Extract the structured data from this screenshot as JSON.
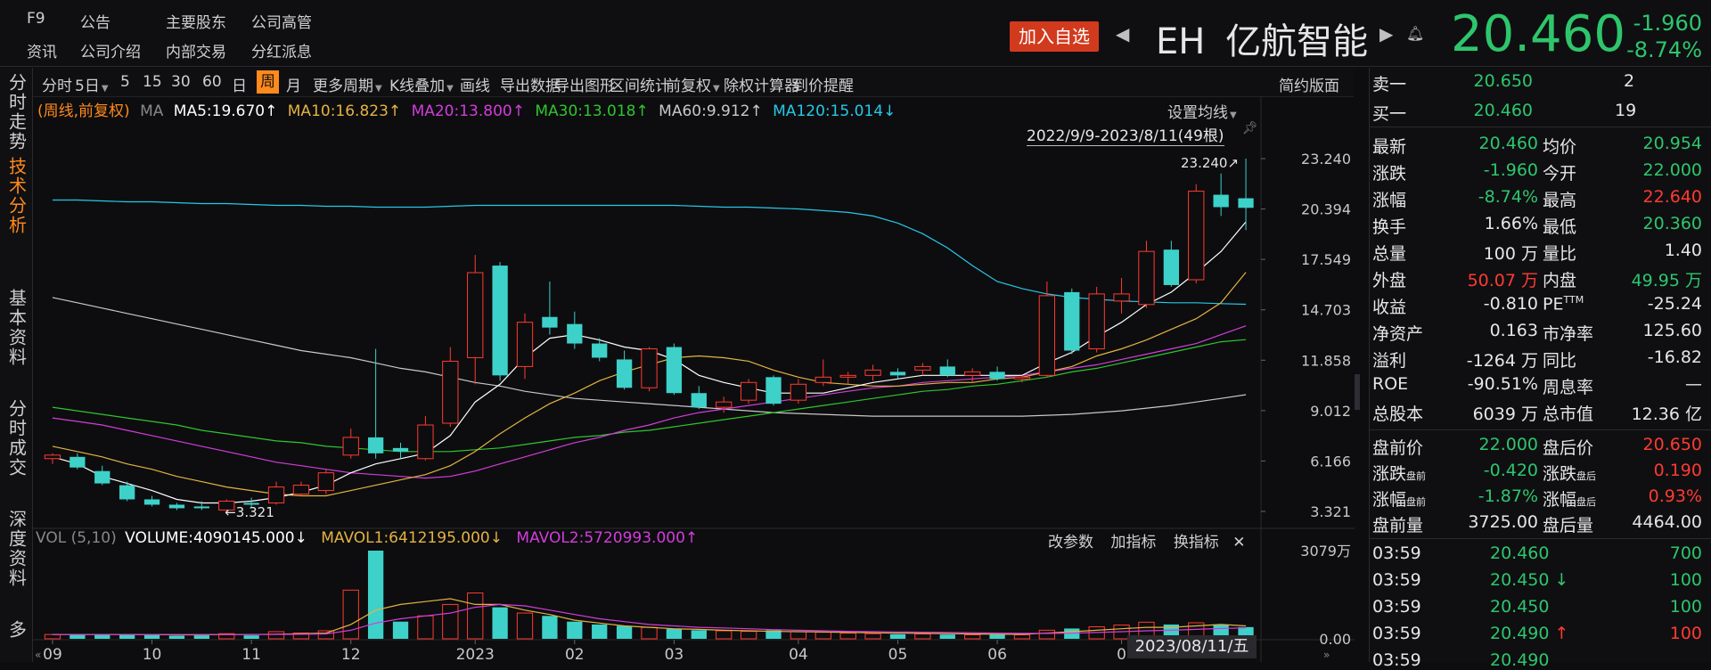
{
  "top_nav": {
    "row1": [
      "F9",
      "公告",
      "主要股东",
      "公司高管"
    ],
    "row2": [
      "资讯",
      "公司介绍",
      "内部交易",
      "分红派息"
    ]
  },
  "header": {
    "add_watch": "加入自选",
    "symbol": "EH",
    "name": "亿航智能",
    "price": "20.460",
    "change": "-1.960",
    "change_pct": "-8.74%"
  },
  "sidebar": [
    "分时走势",
    "技术分析",
    "基本资料",
    "分时成交",
    "深度资料",
    "多"
  ],
  "sidebar_active_index": 1,
  "toolbar": {
    "items": [
      "分时",
      "5日",
      "5",
      "15",
      "30",
      "60",
      "日",
      "周",
      "月",
      "更多周期",
      "K线叠加",
      "画线",
      "导出数据",
      "导出图形",
      "区间统计",
      "前复权",
      "除权计算器",
      "到价提醒"
    ],
    "active_label": "周",
    "right_label": "简约版面"
  },
  "ma_legend": {
    "prefix": "(周线,前复权)",
    "ma_label": "MA",
    "ma5": "MA5:19.670↑",
    "ma10": "MA10:16.823↑",
    "ma20": "MA20:13.800↑",
    "ma30": "MA30:13.018↑",
    "ma60": "MA60:9.912↑",
    "ma120": "MA120:15.014↓"
  },
  "ma_settings": "设置均线",
  "range_label": "2022/9/9-2023/8/11(49根)",
  "vol_legend": {
    "label": "VOL (5,10)",
    "volume": "VOLUME:4090145.000↓",
    "mavol1": "MAVOL1:6412195.000↓",
    "mavol2": "MAVOL2:5720993.000↑"
  },
  "vol_buttons": [
    "改参数",
    "加指标",
    "换指标"
  ],
  "date_cursor": "2023/08/11/五",
  "colors": {
    "up": "#ff3b30",
    "down": "#3dd1c9",
    "ma5": "#ffffff",
    "ma10": "#e3b341",
    "ma20": "#d23ddb",
    "ma30": "#2ec62e",
    "ma60": "#c8c8c8",
    "ma120": "#27c8e8",
    "orange": "#ff8a1c"
  },
  "chart_data": {
    "type": "candlestick",
    "title": "EH 亿航智能",
    "price_ticks": [
      "23.240",
      "20.394",
      "17.549",
      "14.703",
      "11.858",
      "9.012",
      "6.166",
      "3.321"
    ],
    "price_ticks_num": [
      23.24,
      20.394,
      17.549,
      14.703,
      11.858,
      9.012,
      6.166,
      3.321
    ],
    "ylim": [
      3.321,
      23.24
    ],
    "vol_ticks": [
      "3079万",
      "0.00"
    ],
    "vol_max": 3079,
    "x_labels": [
      "09",
      "10",
      "11",
      "12",
      "2023",
      "02",
      "03",
      "04",
      "05",
      "06",
      "0"
    ],
    "x_label_index": [
      0.5,
      4.5,
      8.5,
      12.5,
      17.5,
      21.5,
      25.5,
      30.5,
      34.5,
      38.5,
      43.5
    ],
    "annotations": {
      "high": "23.240↗",
      "low": "←3.321"
    },
    "candles": [
      {
        "o": 6.3,
        "h": 6.6,
        "l": 6.0,
        "c": 6.5,
        "v": 150
      },
      {
        "o": 6.4,
        "h": 6.6,
        "l": 5.7,
        "c": 5.8,
        "v": 160
      },
      {
        "o": 5.6,
        "h": 5.9,
        "l": 4.8,
        "c": 4.9,
        "v": 150
      },
      {
        "o": 4.8,
        "h": 5.0,
        "l": 3.9,
        "c": 4.0,
        "v": 140
      },
      {
        "o": 4.0,
        "h": 4.2,
        "l": 3.6,
        "c": 3.7,
        "v": 130
      },
      {
        "o": 3.7,
        "h": 3.8,
        "l": 3.4,
        "c": 3.5,
        "v": 110
      },
      {
        "o": 3.6,
        "h": 3.9,
        "l": 3.4,
        "c": 3.5,
        "v": 120
      },
      {
        "o": 3.4,
        "h": 4.0,
        "l": 3.32,
        "c": 3.9,
        "v": 180
      },
      {
        "o": 3.8,
        "h": 4.1,
        "l": 3.5,
        "c": 3.7,
        "v": 120
      },
      {
        "o": 3.8,
        "h": 5.0,
        "l": 3.7,
        "c": 4.7,
        "v": 250
      },
      {
        "o": 4.3,
        "h": 5.0,
        "l": 4.2,
        "c": 4.8,
        "v": 200
      },
      {
        "o": 4.5,
        "h": 5.7,
        "l": 4.3,
        "c": 5.5,
        "v": 280
      },
      {
        "o": 6.5,
        "h": 8.0,
        "l": 6.3,
        "c": 7.5,
        "v": 1700
      },
      {
        "o": 7.5,
        "h": 12.5,
        "l": 6.3,
        "c": 6.6,
        "v": 3079
      },
      {
        "o": 6.9,
        "h": 7.2,
        "l": 6.3,
        "c": 6.7,
        "v": 600
      },
      {
        "o": 6.3,
        "h": 8.7,
        "l": 6.2,
        "c": 8.2,
        "v": 800
      },
      {
        "o": 8.3,
        "h": 12.6,
        "l": 8.1,
        "c": 11.8,
        "v": 1200
      },
      {
        "o": 12.0,
        "h": 17.8,
        "l": 10.5,
        "c": 16.8,
        "v": 1600
      },
      {
        "o": 17.2,
        "h": 17.4,
        "l": 10.7,
        "c": 11.0,
        "v": 1100
      },
      {
        "o": 11.5,
        "h": 14.5,
        "l": 10.8,
        "c": 14.0,
        "v": 900
      },
      {
        "o": 14.3,
        "h": 16.3,
        "l": 13.3,
        "c": 13.7,
        "v": 800
      },
      {
        "o": 13.9,
        "h": 14.6,
        "l": 12.5,
        "c": 12.8,
        "v": 600
      },
      {
        "o": 12.8,
        "h": 13.1,
        "l": 11.8,
        "c": 12.0,
        "v": 500
      },
      {
        "o": 11.9,
        "h": 12.4,
        "l": 10.2,
        "c": 10.3,
        "v": 450
      },
      {
        "o": 10.3,
        "h": 12.6,
        "l": 10.1,
        "c": 12.5,
        "v": 400
      },
      {
        "o": 12.6,
        "h": 12.8,
        "l": 9.9,
        "c": 10.0,
        "v": 350
      },
      {
        "o": 10.0,
        "h": 10.4,
        "l": 9.1,
        "c": 9.2,
        "v": 300
      },
      {
        "o": 9.2,
        "h": 9.8,
        "l": 8.9,
        "c": 9.5,
        "v": 280
      },
      {
        "o": 9.6,
        "h": 10.8,
        "l": 9.4,
        "c": 10.6,
        "v": 260
      },
      {
        "o": 10.9,
        "h": 11.0,
        "l": 9.3,
        "c": 9.4,
        "v": 300
      },
      {
        "o": 9.6,
        "h": 10.8,
        "l": 9.4,
        "c": 10.5,
        "v": 250
      },
      {
        "o": 10.6,
        "h": 11.9,
        "l": 10.4,
        "c": 10.9,
        "v": 230
      },
      {
        "o": 10.9,
        "h": 11.2,
        "l": 10.5,
        "c": 11.0,
        "v": 200
      },
      {
        "o": 11.0,
        "h": 11.6,
        "l": 10.7,
        "c": 11.3,
        "v": 180
      },
      {
        "o": 11.2,
        "h": 11.4,
        "l": 10.8,
        "c": 11.0,
        "v": 160
      },
      {
        "o": 11.3,
        "h": 11.7,
        "l": 11.0,
        "c": 11.5,
        "v": 170
      },
      {
        "o": 11.5,
        "h": 11.9,
        "l": 10.9,
        "c": 11.0,
        "v": 150
      },
      {
        "o": 11.0,
        "h": 11.4,
        "l": 10.6,
        "c": 11.2,
        "v": 140
      },
      {
        "o": 11.2,
        "h": 11.5,
        "l": 10.7,
        "c": 10.8,
        "v": 150
      },
      {
        "o": 10.8,
        "h": 11.0,
        "l": 10.6,
        "c": 10.9,
        "v": 140
      },
      {
        "o": 11.0,
        "h": 16.3,
        "l": 10.9,
        "c": 15.5,
        "v": 300
      },
      {
        "o": 15.7,
        "h": 15.9,
        "l": 12.2,
        "c": 12.4,
        "v": 360
      },
      {
        "o": 12.5,
        "h": 16.0,
        "l": 12.3,
        "c": 15.6,
        "v": 420
      },
      {
        "o": 15.2,
        "h": 16.5,
        "l": 14.5,
        "c": 15.6,
        "v": 480
      },
      {
        "o": 15.0,
        "h": 18.6,
        "l": 14.8,
        "c": 18.0,
        "v": 580
      },
      {
        "o": 18.1,
        "h": 18.6,
        "l": 16.0,
        "c": 16.1,
        "v": 500
      },
      {
        "o": 16.4,
        "h": 21.8,
        "l": 16.2,
        "c": 21.4,
        "v": 560
      },
      {
        "o": 21.2,
        "h": 22.4,
        "l": 20.0,
        "c": 20.5,
        "v": 480
      },
      {
        "o": 21.0,
        "h": 23.24,
        "l": 19.2,
        "c": 20.46,
        "v": 409
      }
    ],
    "ma_lines": {
      "ma5": [
        6.4,
        6.0,
        5.3,
        4.9,
        4.5,
        4.0,
        3.8,
        3.8,
        3.9,
        4.1,
        4.4,
        4.8,
        5.5,
        6.0,
        6.3,
        6.6,
        7.6,
        9.5,
        10.5,
        12.0,
        13.1,
        13.3,
        13.0,
        12.6,
        12.4,
        11.9,
        11.0,
        10.6,
        10.3,
        10.0,
        10.0,
        10.0,
        10.3,
        10.6,
        10.8,
        11.0,
        11.0,
        11.0,
        11.0,
        11.0,
        11.7,
        12.3,
        13.2,
        14.0,
        15.0,
        15.7,
        16.8,
        18.0,
        19.67
      ],
      "ma10": [
        7.0,
        6.7,
        6.4,
        6.0,
        5.7,
        5.3,
        5.0,
        4.7,
        4.5,
        4.3,
        4.2,
        4.2,
        4.5,
        4.8,
        5.1,
        5.4,
        5.9,
        6.7,
        7.7,
        8.6,
        9.4,
        10.0,
        10.7,
        11.2,
        11.6,
        12.0,
        12.1,
        12.0,
        11.8,
        11.3,
        10.9,
        10.6,
        10.5,
        10.4,
        10.4,
        10.5,
        10.6,
        10.6,
        10.8,
        10.9,
        11.2,
        11.5,
        12.1,
        12.5,
        13.0,
        13.6,
        14.2,
        15.1,
        16.823
      ],
      "ma20": [
        8.6,
        8.4,
        8.2,
        7.9,
        7.6,
        7.3,
        7.0,
        6.7,
        6.4,
        6.1,
        5.9,
        5.7,
        5.5,
        5.4,
        5.3,
        5.2,
        5.3,
        5.6,
        6.0,
        6.4,
        6.8,
        7.2,
        7.5,
        7.9,
        8.2,
        8.6,
        8.9,
        9.1,
        9.3,
        9.5,
        9.7,
        9.9,
        10.1,
        10.3,
        10.4,
        10.6,
        10.7,
        10.8,
        10.9,
        11.0,
        11.2,
        11.4,
        11.6,
        11.9,
        12.2,
        12.5,
        12.8,
        13.3,
        13.8
      ],
      "ma30": [
        9.2,
        9.0,
        8.8,
        8.6,
        8.4,
        8.2,
        7.9,
        7.7,
        7.5,
        7.3,
        7.2,
        7.0,
        6.9,
        6.8,
        6.7,
        6.7,
        6.7,
        6.8,
        6.9,
        7.1,
        7.3,
        7.5,
        7.6,
        7.8,
        7.9,
        8.1,
        8.3,
        8.5,
        8.7,
        8.9,
        9.1,
        9.3,
        9.5,
        9.7,
        9.9,
        10.1,
        10.2,
        10.4,
        10.5,
        10.7,
        10.9,
        11.2,
        11.4,
        11.7,
        12.0,
        12.3,
        12.6,
        12.9,
        13.018
      ],
      "ma60": [
        15.4,
        15.1,
        14.8,
        14.5,
        14.2,
        13.9,
        13.6,
        13.3,
        13.0,
        12.7,
        12.4,
        12.2,
        12.0,
        11.7,
        11.4,
        11.2,
        10.9,
        10.6,
        10.4,
        10.1,
        9.9,
        9.7,
        9.6,
        9.5,
        9.4,
        9.3,
        9.2,
        9.1,
        9.0,
        8.9,
        8.85,
        8.8,
        8.75,
        8.7,
        8.7,
        8.7,
        8.7,
        8.7,
        8.7,
        8.7,
        8.75,
        8.8,
        8.9,
        9.0,
        9.15,
        9.3,
        9.5,
        9.7,
        9.912
      ],
      "ma120": [
        20.9,
        20.9,
        20.85,
        20.8,
        20.8,
        20.75,
        20.7,
        20.7,
        20.65,
        20.6,
        20.6,
        20.55,
        20.55,
        20.5,
        20.5,
        20.5,
        20.55,
        20.6,
        20.6,
        20.6,
        20.6,
        20.6,
        20.6,
        20.6,
        20.6,
        20.6,
        20.55,
        20.5,
        20.5,
        20.45,
        20.4,
        20.3,
        20.2,
        20.0,
        19.6,
        19.0,
        18.2,
        17.2,
        16.3,
        15.9,
        15.6,
        15.4,
        15.3,
        15.2,
        15.15,
        15.1,
        15.1,
        15.05,
        15.014
      ]
    },
    "mavol1": [
      150,
      150,
      150,
      150,
      145,
      140,
      140,
      150,
      150,
      160,
      180,
      200,
      500,
      1000,
      1200,
      1300,
      1400,
      1200,
      1200,
      1000,
      850,
      650,
      550,
      450,
      400,
      350,
      330,
      300,
      280,
      260,
      250,
      240,
      220,
      210,
      200,
      190,
      180,
      170,
      160,
      160,
      200,
      250,
      300,
      350,
      400,
      400,
      450,
      500,
      450
    ],
    "mavol2": [
      150,
      150,
      150,
      150,
      150,
      150,
      150,
      150,
      150,
      155,
      160,
      170,
      300,
      550,
      700,
      800,
      900,
      1100,
      1200,
      1150,
      1000,
      850,
      700,
      600,
      500,
      450,
      400,
      380,
      350,
      320,
      300,
      280,
      260,
      250,
      240,
      230,
      220,
      210,
      200,
      190,
      190,
      200,
      220,
      250,
      280,
      300,
      330,
      360,
      380
    ]
  },
  "quote": {
    "sell1": {
      "label": "卖一",
      "price": "20.650",
      "vol": "2"
    },
    "buy1": {
      "label": "买一",
      "price": "20.460",
      "vol": "19"
    },
    "rows": [
      [
        {
          "k": "最新",
          "v": "20.460",
          "c": "green"
        },
        {
          "k": "均价",
          "v": "20.954",
          "c": "green"
        }
      ],
      [
        {
          "k": "涨跌",
          "v": "-1.960",
          "c": "green"
        },
        {
          "k": "今开",
          "v": "22.000",
          "c": "green"
        }
      ],
      [
        {
          "k": "涨幅",
          "v": "-8.74%",
          "c": "green"
        },
        {
          "k": "最高",
          "v": "22.640",
          "c": "red"
        }
      ],
      [
        {
          "k": "换手",
          "v": "1.66%",
          "c": "white"
        },
        {
          "k": "最低",
          "v": "20.360",
          "c": "green"
        }
      ],
      [
        {
          "k": "总量",
          "v": "100 万",
          "c": "white"
        },
        {
          "k": "量比",
          "v": "1.40",
          "c": "white"
        }
      ],
      [
        {
          "k": "外盘",
          "v": "50.07 万",
          "c": "red"
        },
        {
          "k": "内盘",
          "v": "49.95 万",
          "c": "green"
        }
      ],
      [
        {
          "k": "收益",
          "v": "-0.810",
          "c": "white"
        },
        {
          "k": "PE TTM",
          "v": "-25.24",
          "c": "white"
        }
      ],
      [
        {
          "k": "净资产",
          "v": "0.163",
          "c": "white"
        },
        {
          "k": "市净率",
          "v": "125.60",
          "c": "white"
        }
      ],
      [
        {
          "k": "溢利",
          "v": "-1264 万",
          "c": "white"
        },
        {
          "k": "同比",
          "v": "-16.82",
          "c": "white"
        }
      ],
      [
        {
          "k": "ROE",
          "v": "-90.51%",
          "c": "white"
        },
        {
          "k": "周息率",
          "v": "—",
          "c": "white"
        }
      ],
      [
        {
          "k": "总股本",
          "v": "6039 万",
          "c": "white"
        },
        {
          "k": "总市值",
          "v": "12.36 亿",
          "c": "white"
        }
      ]
    ],
    "pre_post": [
      [
        {
          "k": "盘前价",
          "v": "22.000",
          "c": "green"
        },
        {
          "k": "盘后价",
          "v": "20.650",
          "c": "red"
        }
      ],
      [
        {
          "k": "涨跌",
          "s": "盘前",
          "v": "-0.420",
          "c": "green"
        },
        {
          "k": "涨跌",
          "s": "盘后",
          "v": "0.190",
          "c": "red"
        }
      ],
      [
        {
          "k": "涨幅",
          "s": "盘前",
          "v": "-1.87%",
          "c": "green"
        },
        {
          "k": "涨幅",
          "s": "盘后",
          "v": "0.93%",
          "c": "red"
        }
      ],
      [
        {
          "k": "盘前量",
          "v": "3725.00",
          "c": "white"
        },
        {
          "k": "盘后量",
          "v": "4464.00",
          "c": "white"
        }
      ]
    ],
    "trades": [
      {
        "t": "03:59",
        "p": "20.460",
        "arrow": "",
        "v": "700",
        "pc": "green",
        "vc": "green"
      },
      {
        "t": "03:59",
        "p": "20.450",
        "arrow": "↓",
        "v": "100",
        "pc": "green",
        "vc": "green"
      },
      {
        "t": "03:59",
        "p": "20.450",
        "arrow": "",
        "v": "100",
        "pc": "green",
        "vc": "green"
      },
      {
        "t": "03:59",
        "p": "20.490",
        "arrow": "↑",
        "v": "100",
        "pc": "green",
        "vc": "red"
      },
      {
        "t": "03:59",
        "p": "20.490",
        "arrow": "",
        "v": "",
        "pc": "green",
        "vc": "green"
      }
    ]
  }
}
